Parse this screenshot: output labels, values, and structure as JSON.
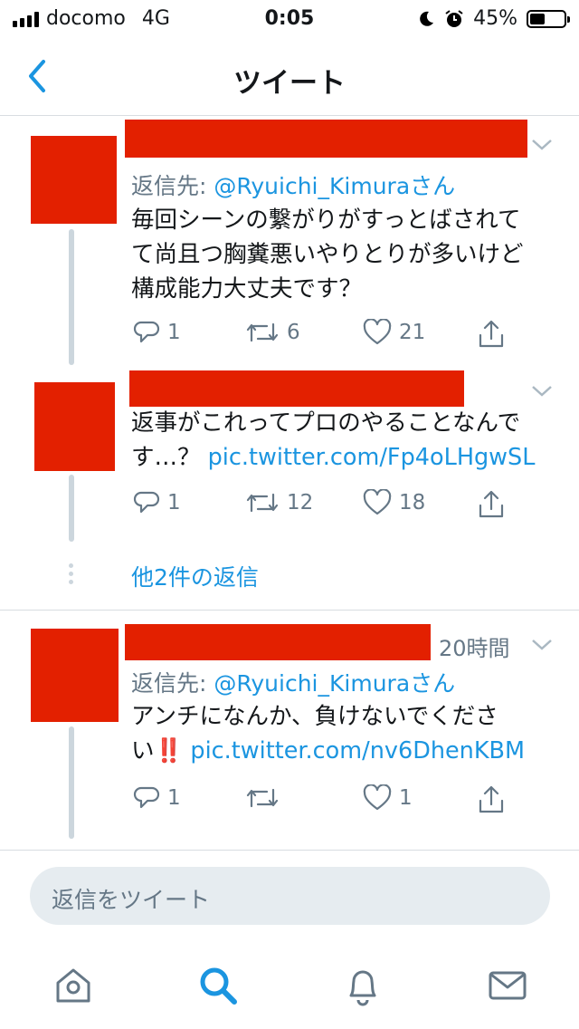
{
  "status_bar": {
    "carrier": "docomo",
    "network": "4G",
    "time": "0:05",
    "battery": "45%",
    "battery_level": 0.45
  },
  "nav": {
    "title": "ツイート"
  },
  "tweets": [
    {
      "reply_to_prefix": "返信先: ",
      "reply_to_handle": "@Ryuichi_Kimuraさん",
      "text": "毎回シーンの繋がりがすっとばされてて尚且つ胸糞悪いやりとりが多いけど構成能力大丈夫です？",
      "replies": "1",
      "retweets": "6",
      "likes": "21"
    },
    {
      "text": "返事がこれってプロのやることなんです…？ ",
      "link": "pic.twitter.com/Fp4oLHgwSL",
      "replies": "1",
      "retweets": "12",
      "likes": "18"
    },
    {
      "time": "20時間",
      "reply_to_prefix": "返信先: ",
      "reply_to_handle": "@Ryuichi_Kimuraさん",
      "text": "アンチになんか、負けないでください",
      "emoji": "‼️",
      "link": "pic.twitter.com/nv6DhenKBM",
      "replies": "1",
      "retweets": "",
      "likes": "1"
    }
  ],
  "more_replies": "他2件の返信",
  "composer": {
    "placeholder": "返信をツイート"
  },
  "tabs": [
    "home-icon",
    "search-icon",
    "notifications-icon",
    "messages-icon"
  ],
  "colors": {
    "accent": "#1b95e0",
    "redaction": "#e32000",
    "muted": "#657786"
  }
}
